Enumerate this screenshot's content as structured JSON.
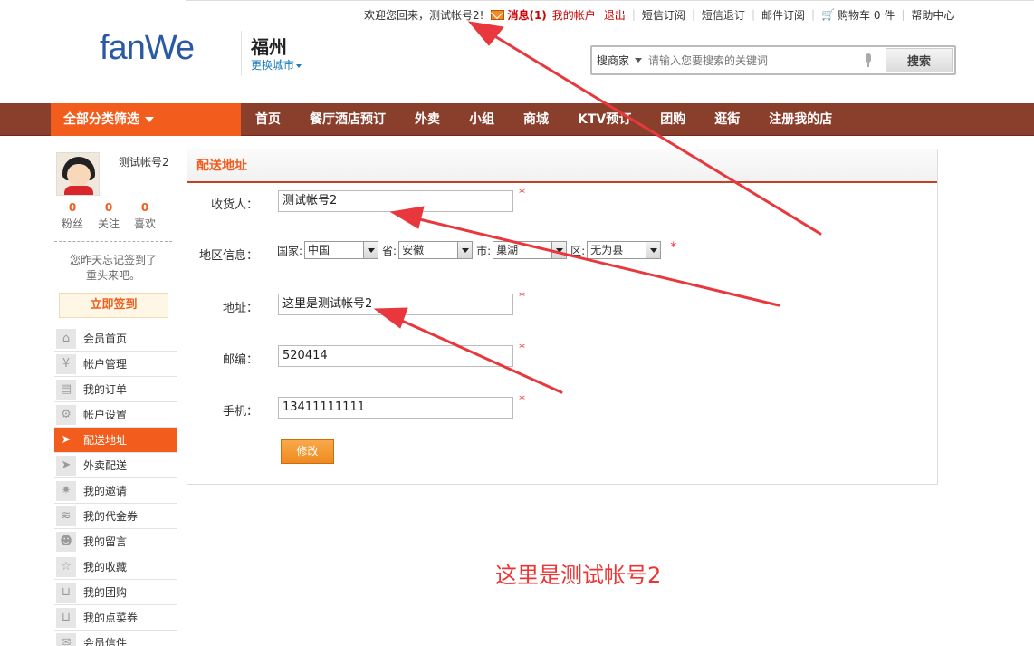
{
  "topbar": {
    "welcome": "欢迎您回来，测试帐号2!",
    "messages": "消息(1)",
    "my_account": "我的帐户",
    "logout": "退出",
    "sms_subscribe": "短信订阅",
    "sms_unsubscribe": "短信退订",
    "email_subscribe": "邮件订阅",
    "cart": "购物车 0 件",
    "help": "帮助中心"
  },
  "header": {
    "logo_text": "fanWe",
    "city": "福州",
    "switch_city": "更换城市"
  },
  "search": {
    "type": "搜商家",
    "placeholder": "请输入您要搜索的关键词",
    "button": "搜索"
  },
  "nav": {
    "all_categories": "全部分类筛选",
    "items": [
      "首页",
      "餐厅酒店预订",
      "外卖",
      "小组",
      "商城",
      "KTV预订",
      "团购",
      "逛街",
      "注册我的店"
    ]
  },
  "user": {
    "name": "测试帐号2",
    "stats": [
      {
        "value": "0",
        "label": "粉丝"
      },
      {
        "value": "0",
        "label": "关注"
      },
      {
        "value": "0",
        "label": "喜欢"
      }
    ],
    "checkin_tip_1": "您昨天忘记签到了",
    "checkin_tip_2": "重头来吧。",
    "checkin_button": "立即签到"
  },
  "menu": [
    {
      "label": "会员首页",
      "icon": "home-icon",
      "glyph": "⌂"
    },
    {
      "label": "帐户管理",
      "icon": "yen-icon",
      "glyph": "¥"
    },
    {
      "label": "我的订单",
      "icon": "document-icon",
      "glyph": "▤"
    },
    {
      "label": "帐户设置",
      "icon": "gear-icon",
      "glyph": "⚙"
    },
    {
      "label": "配送地址",
      "icon": "delivery-icon",
      "glyph": "➤",
      "active": true
    },
    {
      "label": "外卖配送",
      "icon": "takeout-icon",
      "glyph": "➤"
    },
    {
      "label": "我的邀请",
      "icon": "invite-icon",
      "glyph": "✷"
    },
    {
      "label": "我的代金券",
      "icon": "coupon-icon",
      "glyph": "≋"
    },
    {
      "label": "我的留言",
      "icon": "users-icon",
      "glyph": "☻"
    },
    {
      "label": "我的收藏",
      "icon": "star-icon",
      "glyph": "☆"
    },
    {
      "label": "我的团购",
      "icon": "cart-icon",
      "glyph": "⊔"
    },
    {
      "label": "我的点菜券",
      "icon": "cart-icon",
      "glyph": "⊔"
    },
    {
      "label": "会员信件",
      "icon": "mail-icon",
      "glyph": "✉"
    }
  ],
  "form": {
    "title": "配送地址",
    "consignee_label": "收货人：",
    "consignee_value": "测试帐号2",
    "region_label": "地区信息：",
    "country_label": "国家:",
    "country_value": "中国",
    "province_label": "省:",
    "province_value": "安徽",
    "city_label": "市:",
    "city_value": "巢湖",
    "district_label": "区:",
    "district_value": "无为县",
    "address_label": "地址：",
    "address_value": "这里是测试帐号2",
    "zip_label": "邮编：",
    "zip_value": "520414",
    "mobile_label": "手机：",
    "mobile_value": "13411111111",
    "required_mark": "*",
    "submit": "修改"
  },
  "annotation_text": "这里是测试帐号2"
}
